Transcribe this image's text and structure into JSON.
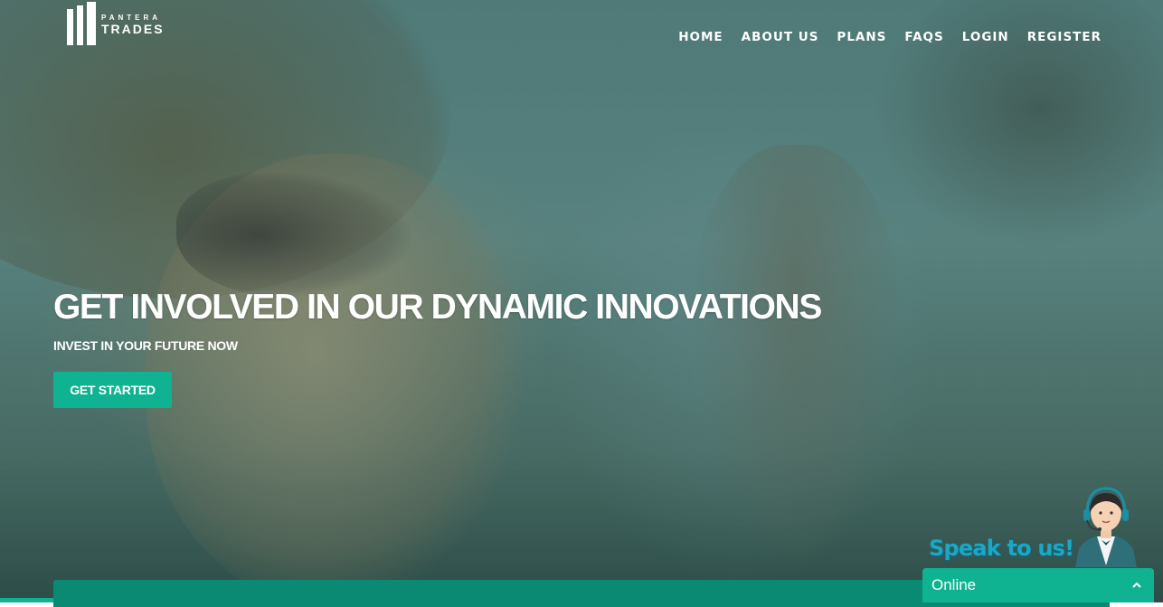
{
  "brand": {
    "line1": "PANTERA",
    "line2": "TRADES"
  },
  "nav": {
    "items": [
      {
        "label": "HOME"
      },
      {
        "label": "ABOUT US"
      },
      {
        "label": "PLANS"
      },
      {
        "label": "FAQS"
      },
      {
        "label": "LOGIN"
      },
      {
        "label": "REGISTER"
      }
    ]
  },
  "hero": {
    "headline": "GET INVOLVED IN OUR DYNAMIC INNOVATIONS",
    "subline": "INVEST IN YOUR FUTURE NOW",
    "cta_label": "GET STARTED"
  },
  "chat": {
    "callout": "Speak to us!",
    "status": "Online",
    "toggle_icon": "chevron-up-icon",
    "agent_icon": "support-agent-icon"
  },
  "colors": {
    "accent": "#0fb391",
    "panel": "#0a8a72",
    "overlay": "#124e48",
    "callout": "#1aa8c6"
  }
}
